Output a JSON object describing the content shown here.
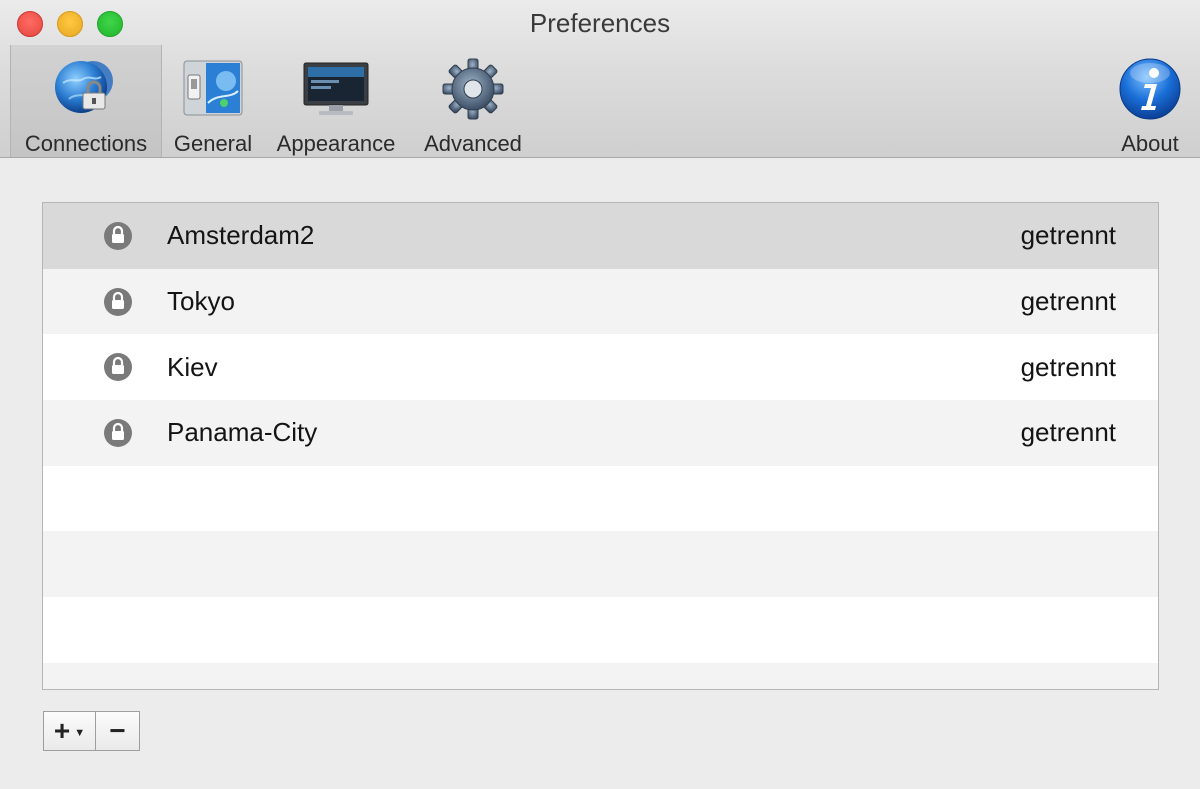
{
  "window": {
    "title": "Preferences"
  },
  "toolbar": {
    "connections": "Connections",
    "general": "General",
    "appearance": "Appearance",
    "advanced": "Advanced",
    "about": "About"
  },
  "connections": [
    {
      "name": "Amsterdam2",
      "status": "getrennt"
    },
    {
      "name": "Tokyo",
      "status": "getrennt"
    },
    {
      "name": "Kiev",
      "status": "getrennt"
    },
    {
      "name": "Panama-City",
      "status": "getrennt"
    }
  ],
  "controls": {
    "add": "+",
    "remove": "−"
  },
  "colors": {
    "selected_row": "#d9d9d9",
    "about_blue": "#1a6fd8"
  }
}
